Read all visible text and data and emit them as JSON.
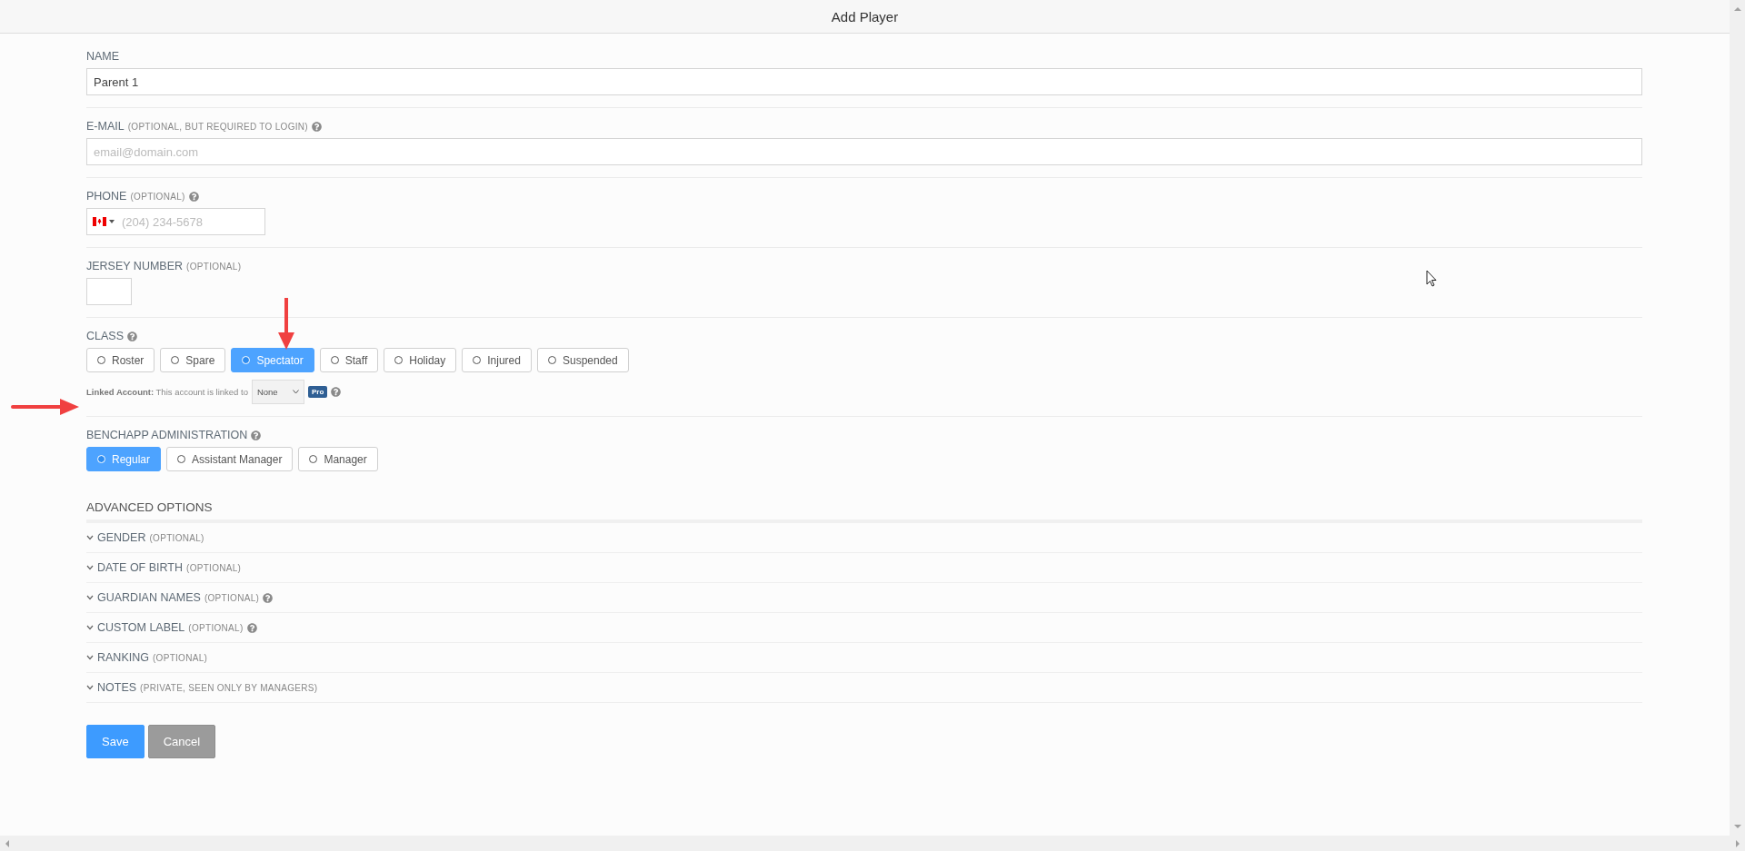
{
  "window": {
    "title": "Add Player"
  },
  "fields": [
    {
      "kind": "text",
      "label": "NAME",
      "value": "Parent 1"
    },
    {
      "kind": "text",
      "label": "E-MAIL",
      "note": "(OPTIONAL, BUT REQUIRED TO LOGIN)",
      "help": true,
      "placeholder": "email@domain.com"
    },
    {
      "kind": "phone",
      "label": "PHONE",
      "note": "(OPTIONAL)",
      "help": true,
      "placeholder": "(204) 234-5678"
    },
    {
      "kind": "short",
      "label": "JERSEY NUMBER",
      "note": "(OPTIONAL)"
    }
  ],
  "class": {
    "label": "CLASS",
    "help": true,
    "options": [
      {
        "label": "Roster",
        "selected": false
      },
      {
        "label": "Spare",
        "selected": false
      },
      {
        "label": "Spectator",
        "selected": true
      },
      {
        "label": "Staff",
        "selected": false
      },
      {
        "label": "Holiday",
        "selected": false
      },
      {
        "label": "Injured",
        "selected": false
      },
      {
        "label": "Suspended",
        "selected": false
      }
    ]
  },
  "linked_account": {
    "text": "**Linked Account:** This account is linked to",
    "value": "None",
    "badge": "Pro",
    "help": true
  },
  "administration": {
    "label": "BENCHAPP ADMINISTRATION",
    "help": true,
    "options": [
      {
        "label": "Regular",
        "selected": true
      },
      {
        "label": "Assistant Manager",
        "selected": false
      },
      {
        "label": "Manager",
        "selected": false
      }
    ]
  },
  "advanced": {
    "title": "ADVANCED OPTIONS",
    "rows": [
      {
        "label": "GENDER",
        "note": "(OPTIONAL)",
        "help": false,
        "expanded": false
      },
      {
        "label": "DATE OF BIRTH",
        "note": "(OPTIONAL)",
        "help": false,
        "expanded": false
      },
      {
        "label": "GUARDIAN NAMES",
        "note": "(OPTIONAL)",
        "help": true,
        "expanded": false
      },
      {
        "label": "CUSTOM LABEL",
        "note": "(OPTIONAL)",
        "help": true,
        "expanded": false
      },
      {
        "label": "RANKING",
        "note": "(OPTIONAL)",
        "help": false,
        "expanded": false
      },
      {
        "label": "NOTES",
        "note": "(PRIVATE, SEEN ONLY BY MANAGERS)",
        "help": false,
        "expanded": false
      }
    ]
  },
  "buttons": [
    {
      "kind": "primary",
      "label": "Save"
    },
    {
      "kind": "secondary",
      "label": "Cancel"
    }
  ]
}
